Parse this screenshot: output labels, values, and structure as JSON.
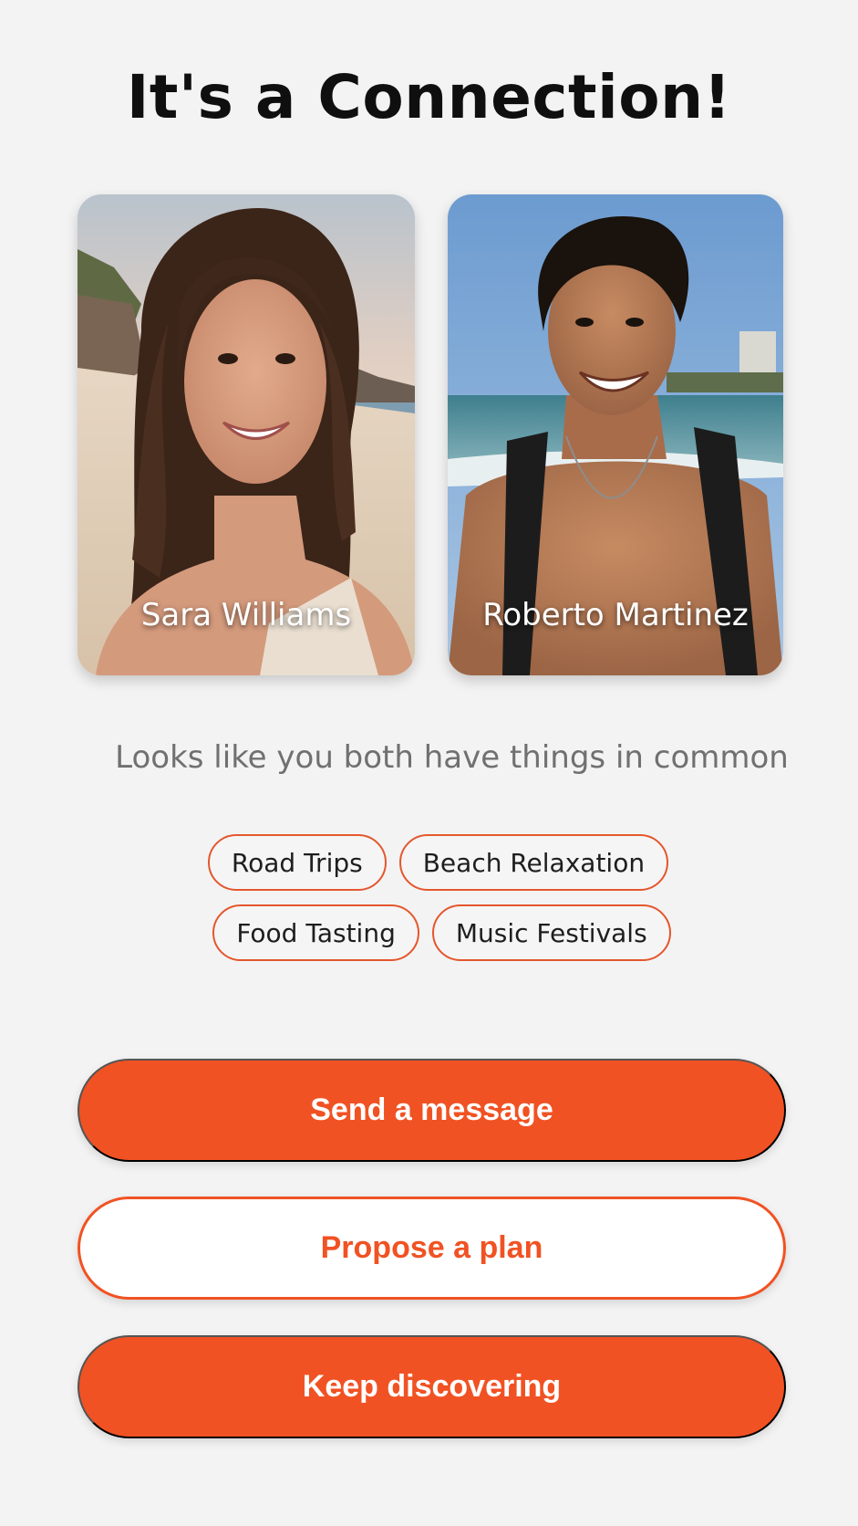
{
  "header": {
    "title": "It's a Connection!"
  },
  "profiles": [
    {
      "name": "Sara Williams"
    },
    {
      "name": "Roberto Martinez"
    }
  ],
  "common": {
    "subtitle": "Looks like you both have things in common",
    "interests": [
      "Road Trips",
      "Beach Relaxation",
      "Food Tasting",
      "Music Festivals"
    ]
  },
  "actions": {
    "send_message": "Send a message",
    "propose_plan": "Propose a plan",
    "keep_discovering": "Keep discovering"
  },
  "colors": {
    "accent": "#f15223",
    "background": "#f3f3f3"
  }
}
